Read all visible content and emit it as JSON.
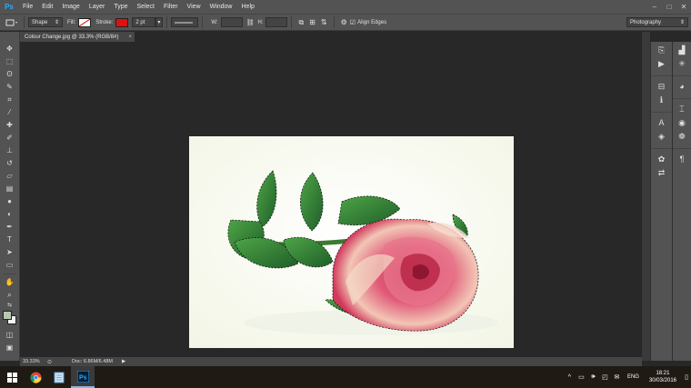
{
  "app": {
    "logo_text": "Ps"
  },
  "menu": [
    "File",
    "Edit",
    "Image",
    "Layer",
    "Type",
    "Select",
    "Filter",
    "View",
    "Window",
    "Help"
  ],
  "window_controls": [
    "–",
    "□",
    "✕"
  ],
  "options": {
    "mode_label": "Shape",
    "fill_label": "Fill:",
    "stroke_label": "Stroke:",
    "stroke_color": "#e01010",
    "stroke_width": "2 pt",
    "w_label": "W:",
    "h_label": "H:",
    "align_edges_label": "Align Edges",
    "workspace": "Photography"
  },
  "document": {
    "tab_title": "Colour Change.jpg @ 33.3% (RGB/8#)",
    "tab_close": "×"
  },
  "colors": {
    "foreground": "#b8c8b0",
    "background": "#f4f4f4"
  },
  "status": {
    "zoom": "33.33%",
    "doc_info": "Doc: 6.86M/6.48M",
    "arrow": "▶"
  },
  "taskbar": {
    "lang": "ENG",
    "time": "18:21",
    "date": "30/03/2016"
  }
}
